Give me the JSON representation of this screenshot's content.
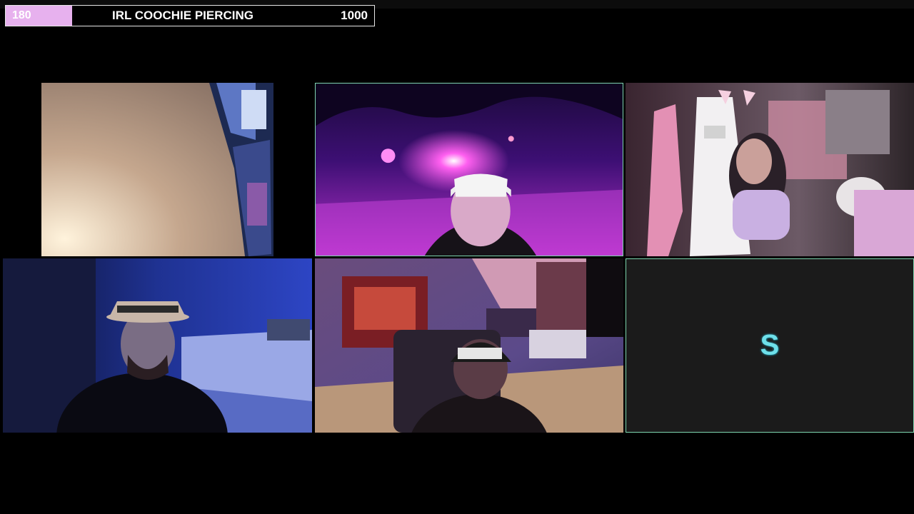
{
  "goal": {
    "current": "180",
    "title": "IRL COOCHIE PIERCING",
    "target": "1000",
    "progress_fraction": 0.18,
    "fill_color": "#e7b1ee"
  },
  "tiles": [
    {
      "id": "cam-1",
      "scene": "wall-and-monitor"
    },
    {
      "id": "cam-2",
      "scene": "street-night-purple"
    },
    {
      "id": "cam-3",
      "scene": "bedroom-gaming-chair"
    },
    {
      "id": "cam-4",
      "scene": "blue-bedroom"
    },
    {
      "id": "cam-5",
      "scene": "room-with-posters"
    },
    {
      "id": "cam-6",
      "scene": "placeholder-logo",
      "logo_text": "S"
    }
  ],
  "colors": {
    "background": "#000000",
    "active_border": "#7fd6b0",
    "logo": "#6ee0ea"
  }
}
